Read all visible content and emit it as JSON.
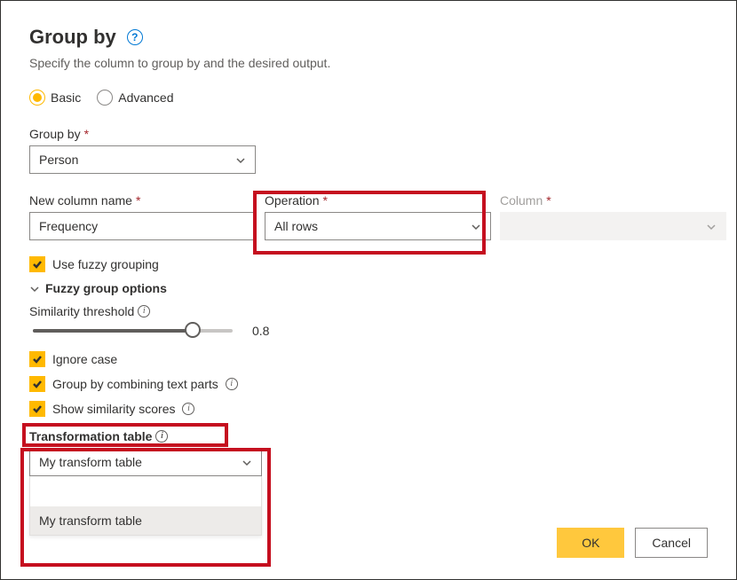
{
  "dialog": {
    "title": "Group by",
    "subtitle": "Specify the column to group by and the desired output."
  },
  "mode": {
    "basic": "Basic",
    "advanced": "Advanced"
  },
  "fields": {
    "group_by_label": "Group by",
    "group_by_value": "Person",
    "new_column_label": "New column name",
    "new_column_value": "Frequency",
    "operation_label": "Operation",
    "operation_value": "All rows",
    "column_label": "Column",
    "column_value": ""
  },
  "fuzzy": {
    "use_fuzzy": "Use fuzzy grouping",
    "options_header": "Fuzzy group options",
    "similarity_label": "Similarity threshold",
    "similarity_value": "0.8",
    "ignore_case": "Ignore case",
    "combine_text": "Group by combining text parts",
    "show_scores": "Show similarity scores",
    "transform_label": "Transformation table",
    "transform_value": "My transform table",
    "transform_option": "My transform table"
  },
  "footer": {
    "ok": "OK",
    "cancel": "Cancel"
  }
}
